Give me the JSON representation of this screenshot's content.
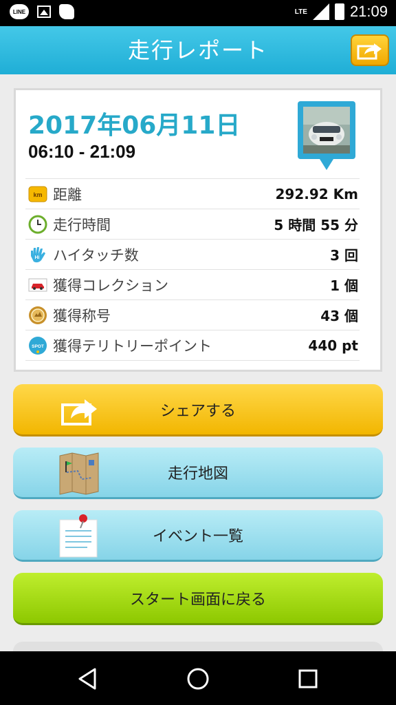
{
  "status_bar": {
    "app_icons": [
      "line-icon",
      "image-icon",
      "bird-icon"
    ],
    "line_label": "LINE",
    "network": "LTE",
    "time": "21:09"
  },
  "header": {
    "title": "走行レポート"
  },
  "summary": {
    "date": "2017年06月11日",
    "time_range": "06:10 - 21:09",
    "rows": [
      {
        "icon": "km-icon",
        "icon_text": "km",
        "label": "距離",
        "value": "292.92 Km"
      },
      {
        "icon": "clock-icon",
        "label": "走行時間",
        "value": "5 時間 55 分"
      },
      {
        "icon": "hightouch-icon",
        "icon_text": "Hi",
        "label": "ハイタッチ数",
        "value": "3 回"
      },
      {
        "icon": "car-icon",
        "label": "獲得コレクション",
        "value": "1 個"
      },
      {
        "icon": "medal-icon",
        "label": "獲得称号",
        "value": "43 個"
      },
      {
        "icon": "spot-icon",
        "icon_text": "SPOT",
        "label": "獲得テリトリーポイント",
        "value": "440 pt"
      }
    ]
  },
  "buttons": {
    "share": "シェアする",
    "map": "走行地図",
    "events": "イベント一覧",
    "start": "スタート画面に戻る"
  },
  "colors": {
    "header": "#1faed6",
    "accent_date": "#27a9c9",
    "share_button": "#f2b600",
    "blue_button": "#86d4e8",
    "green_button": "#8dc800"
  }
}
